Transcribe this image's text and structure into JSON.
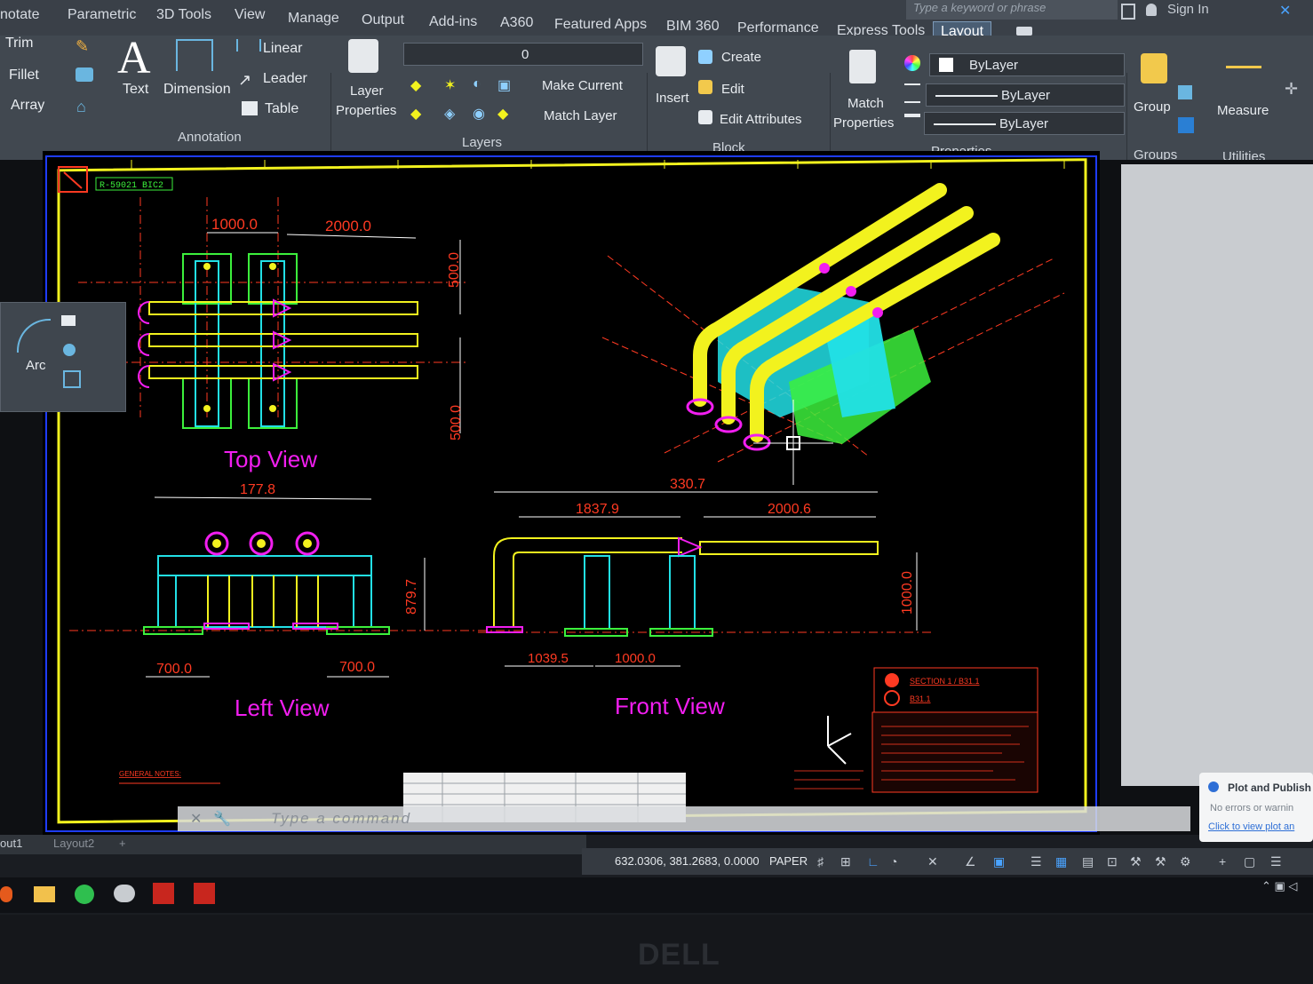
{
  "ribbon_tabs": [
    "notate",
    "Parametric",
    "3D Tools",
    "View",
    "Manage",
    "Output",
    "Add-ins",
    "A360",
    "Featured Apps",
    "BIM 360",
    "Performance",
    "Express Tools",
    "Layout"
  ],
  "search": {
    "placeholder": "Type a keyword or phrase"
  },
  "sign_in": "Sign In",
  "modify": {
    "trim": "Trim",
    "fillet": "Fillet",
    "array": "Array"
  },
  "annotation": {
    "text": "Text",
    "dimension": "Dimension",
    "linear": "Linear",
    "leader": "Leader",
    "table": "Table",
    "title": "Annotation"
  },
  "layers": {
    "layer_properties_1": "Layer",
    "layer_properties_2": "Properties",
    "current_layer": "0",
    "make_current": "Make Current",
    "match_layer": "Match Layer",
    "title": "Layers"
  },
  "block": {
    "insert": "Insert",
    "create": "Create",
    "edit": "Edit",
    "edit_attributes": "Edit Attributes",
    "title": "Block"
  },
  "properties": {
    "match_1": "Match",
    "match_2": "Properties",
    "color": "ByLayer",
    "linetype": "ByLayer",
    "lineweight": "ByLayer",
    "title": "Properties"
  },
  "groups": {
    "group": "Group",
    "title": "Groups"
  },
  "utilities": {
    "measure": "Measure",
    "title": "Utilities"
  },
  "palette": {
    "arc": "Arc"
  },
  "drawing": {
    "title_tag": "R-59021 BIC2",
    "top_view": {
      "label": "Top View",
      "dim_1000": "1000.0",
      "dim_2000": "2000.0",
      "dim_500_a": "500.0",
      "dim_500_b": "500.0"
    },
    "left_view": {
      "label": "Left View",
      "dim_width": "177.8",
      "dim_height": "879.7",
      "dim_left": "700.0",
      "dim_right": "700.0"
    },
    "front_view": {
      "label": "Front View",
      "dim_total": "330.7",
      "dim_a": "1837.9",
      "dim_b": "2000.6",
      "dim_height": "1000.0",
      "dim_c": "1039.5",
      "dim_d": "1000.0"
    },
    "legend": {
      "row1": "SECTION 1 / B31.1",
      "row2": "B31.1"
    },
    "general_notes": "GENERAL NOTES:"
  },
  "command_line": {
    "placeholder": "Type a command"
  },
  "layout_tabs": [
    "out1",
    "Layout2"
  ],
  "status": {
    "coords": "632.0306, 381.2683, 0.0000",
    "space": "PAPER"
  },
  "notification": {
    "title": "Plot and Publish",
    "body": "No errors or warnin",
    "link": "Click to view plot an"
  },
  "brand": "DELL",
  "colors": {
    "yellow": "#f2f21e",
    "cyan": "#22e0e6",
    "green": "#3cf03c",
    "magenta": "#f21ef0",
    "red": "#ff3a22",
    "blue_frame": "#1e3cff"
  }
}
